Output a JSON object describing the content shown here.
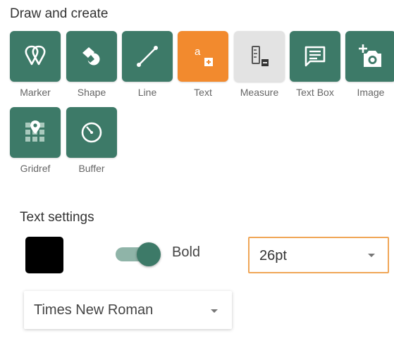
{
  "draw": {
    "title": "Draw and create",
    "tools": [
      {
        "label": "Marker",
        "icon": "marker-icon",
        "state": "normal"
      },
      {
        "label": "Shape",
        "icon": "shape-icon",
        "state": "normal"
      },
      {
        "label": "Line",
        "icon": "line-icon",
        "state": "normal"
      },
      {
        "label": "Text",
        "icon": "text-icon",
        "state": "active"
      },
      {
        "label": "Measure",
        "icon": "measure-icon",
        "state": "disabled"
      },
      {
        "label": "Text Box",
        "icon": "text-box-icon",
        "state": "normal"
      },
      {
        "label": "Image",
        "icon": "add-image-icon",
        "state": "normal"
      },
      {
        "label": "Gridref",
        "icon": "gridref-icon",
        "state": "normal"
      },
      {
        "label": "Buffer",
        "icon": "buffer-icon",
        "state": "normal"
      }
    ]
  },
  "text_settings": {
    "title": "Text settings",
    "color": "#000000",
    "bold_label": "Bold",
    "bold_on": true,
    "size": "26pt",
    "font": "Times New Roman"
  },
  "colors": {
    "tool_green": "#3d7a68",
    "tool_active": "#f28a2e",
    "tool_disabled": "#e3e3e3",
    "select_focus_border": "#f0a657"
  }
}
